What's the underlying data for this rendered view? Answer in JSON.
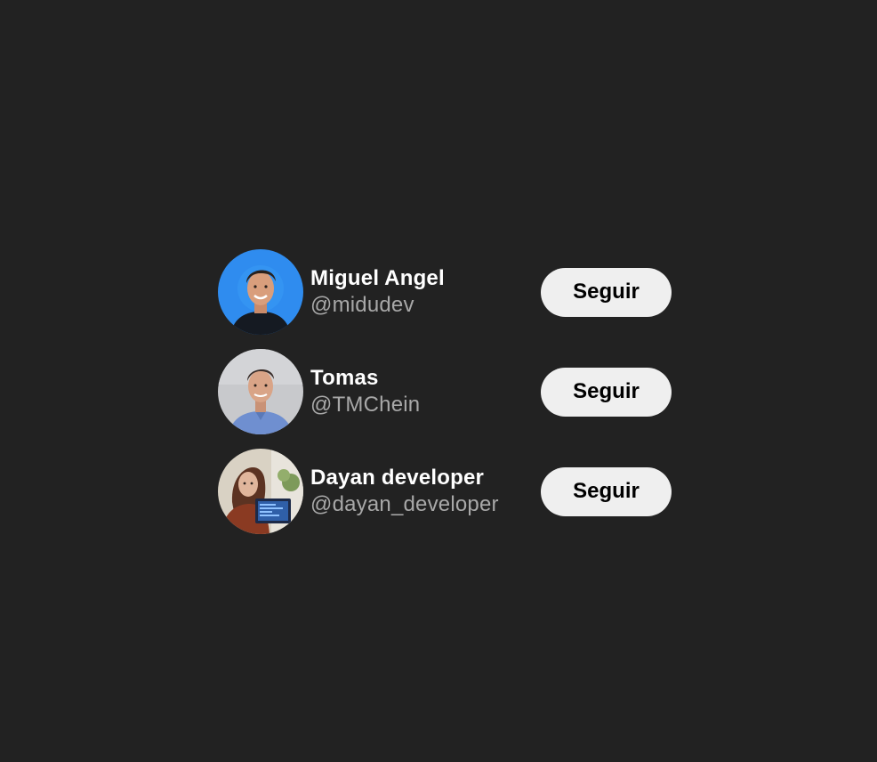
{
  "follow_list": [
    {
      "name": "Miguel Angel",
      "handle": "@midudev",
      "button_label": "Seguir",
      "avatar_bg": "#2f8cef"
    },
    {
      "name": "Tomas",
      "handle": "@TMChein",
      "button_label": "Seguir",
      "avatar_bg": "#c8c9cc"
    },
    {
      "name": "Dayan developer",
      "handle": "@dayan_developer",
      "button_label": "Seguir",
      "avatar_bg": "#d9d2c4"
    }
  ],
  "colors": {
    "background": "#222222",
    "name_text": "#ffffff",
    "handle_text": "#a8a8a8",
    "button_bg": "#efefef",
    "button_text": "#000000"
  }
}
